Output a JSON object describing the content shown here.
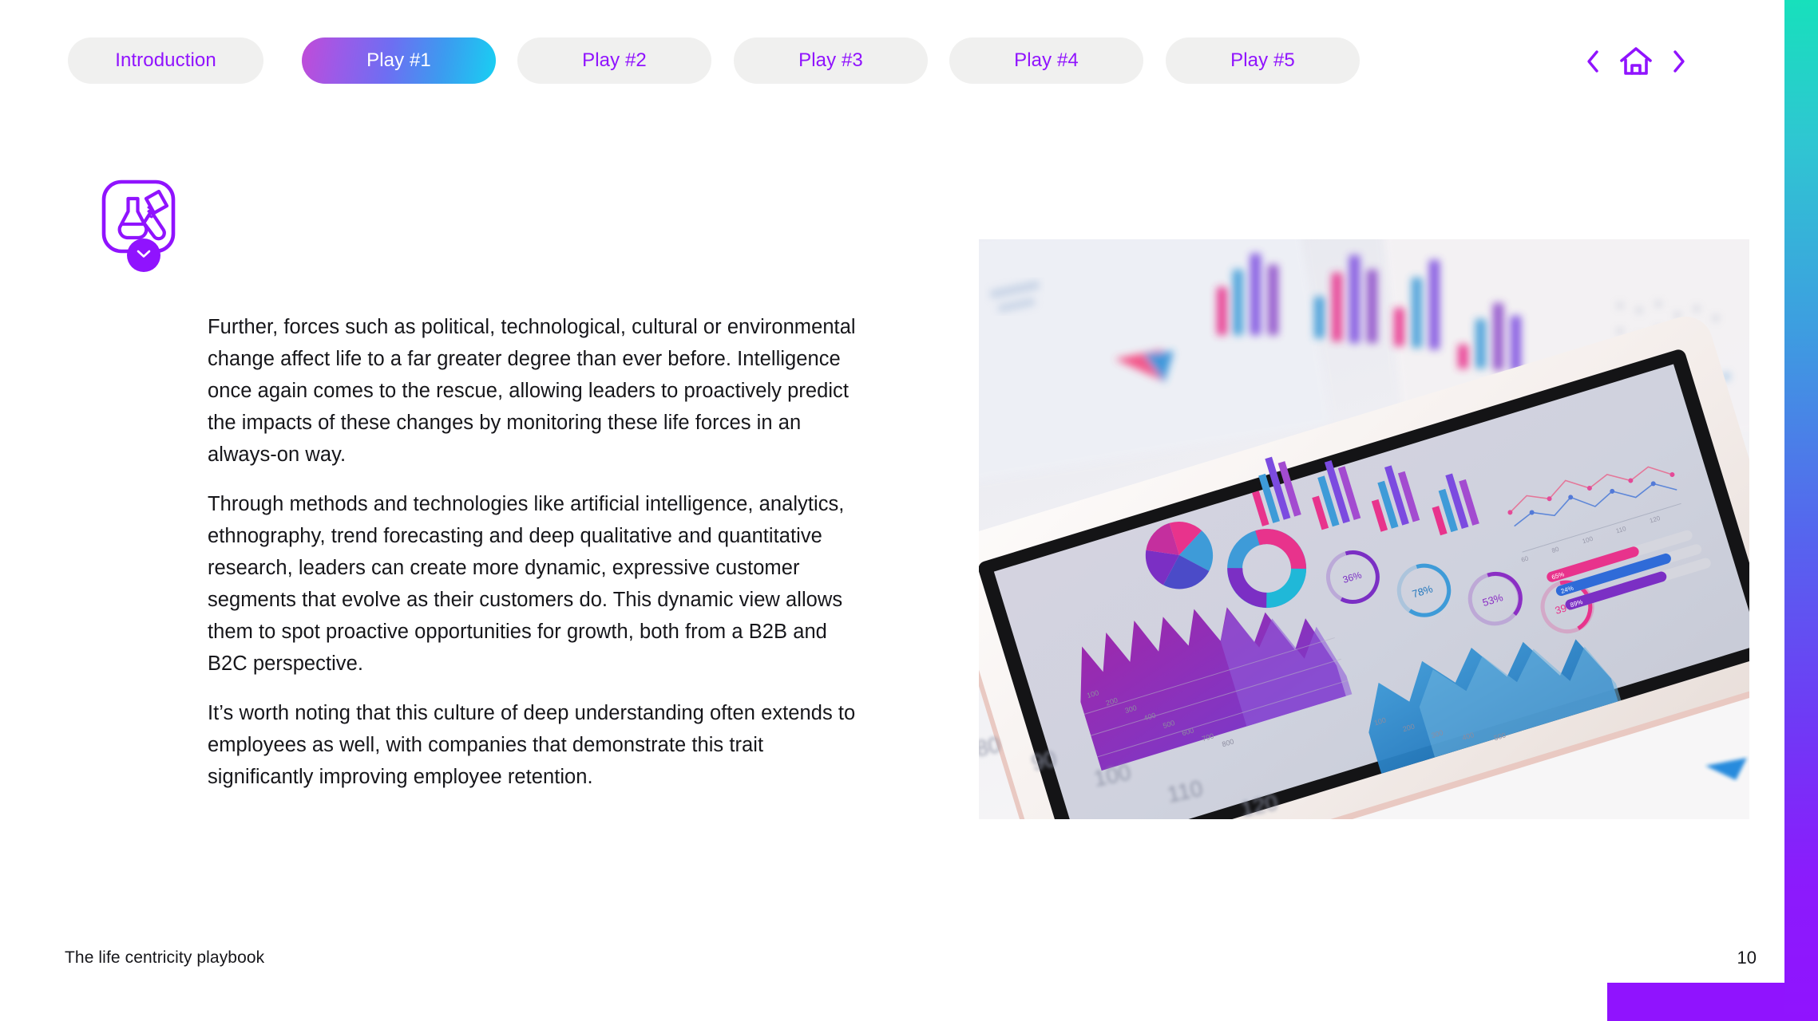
{
  "deck": {
    "footer_title": "The life centricity playbook",
    "page_number": "10"
  },
  "nav": {
    "tabs": [
      {
        "label": "Introduction",
        "active": false
      },
      {
        "label": "Play #1",
        "active": true
      },
      {
        "label": "Play #2",
        "active": false
      },
      {
        "label": "Play #3",
        "active": false
      },
      {
        "label": "Play #4",
        "active": false
      },
      {
        "label": "Play #5",
        "active": false
      }
    ],
    "controls": [
      {
        "name": "prev-slide-button",
        "icon": "chevron-left-icon"
      },
      {
        "name": "home-button",
        "icon": "home-icon"
      },
      {
        "name": "next-slide-button",
        "icon": "chevron-right-icon"
      }
    ]
  },
  "topic": {
    "icon": "flask-test-tube-icon",
    "badge_icon": "chevron-down-icon"
  },
  "content": {
    "paragraphs": [
      "Further, forces such as political, technological, cultural or environmental change affect life to a far greater degree than ever before. Intelligence once again comes to the rescue, allowing leaders to proactively predict the impacts of these changes by monitoring these life forces in an always-on way.",
      "Through methods and technologies like artificial intelligence, analytics, ethnography, trend forecasting and deep qualitative and quantitative research, leaders can create more dynamic, expressive customer segments that evolve as their customers do. This dynamic view allows them to spot proactive opportunities for growth, both from a B2B and B2C perspective.",
      "It’s worth noting that this culture of deep understanding often extends to employees as well, with companies that demonstrate this trait significantly improving employee retention."
    ]
  },
  "photo": {
    "alt": "Tablet displaying colorful analytics dashboard resting on printed report pages",
    "printed_axis_labels": [
      "80",
      "90",
      "100",
      "110",
      "120"
    ],
    "dashboard_gauge_labels": [
      "78%",
      "53%",
      "39%"
    ]
  },
  "colors": {
    "brand_purple": "#9013FE",
    "tab_inactive_bg": "#F0F0EF",
    "tab_active_gradient_start": "#C14BD8",
    "tab_active_gradient_end": "#18D0F2",
    "rail_gradient_start": "#17E0BC",
    "rail_gradient_end": "#9013FE",
    "body_text": "#16161A"
  }
}
